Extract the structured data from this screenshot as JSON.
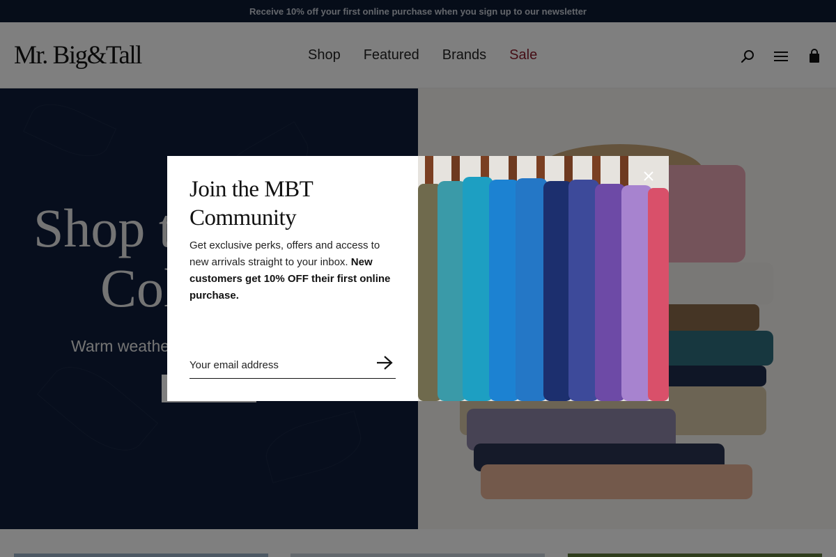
{
  "announcement": {
    "text": "Receive 10% off your first online purchase when you sign up to our newsletter"
  },
  "header": {
    "logo": "Mr. Big&Tall",
    "nav": [
      {
        "label": "Shop"
      },
      {
        "label": "Featured"
      },
      {
        "label": "Brands"
      },
      {
        "label": "Sale"
      }
    ],
    "icons": [
      "search-icon",
      "menu-icon",
      "shopping-bag-icon"
    ]
  },
  "hero": {
    "title_line1": "Shop t",
    "title_line2": "Col",
    "subtitle": "Warm weathe"
  },
  "modal": {
    "title_line1": "Join the MBT",
    "title_line2": "Community",
    "body": "Get exclusive perks, offers and access to new arrivals straight to your inbox.",
    "body_bold": "New customers get 10% OFF their first online purchase.",
    "email_placeholder": "Your email address"
  },
  "colors": {
    "announcement_bg": "#0c1a33",
    "hero_bg": "#0e1d3b",
    "sale": "#8b1d2c"
  }
}
